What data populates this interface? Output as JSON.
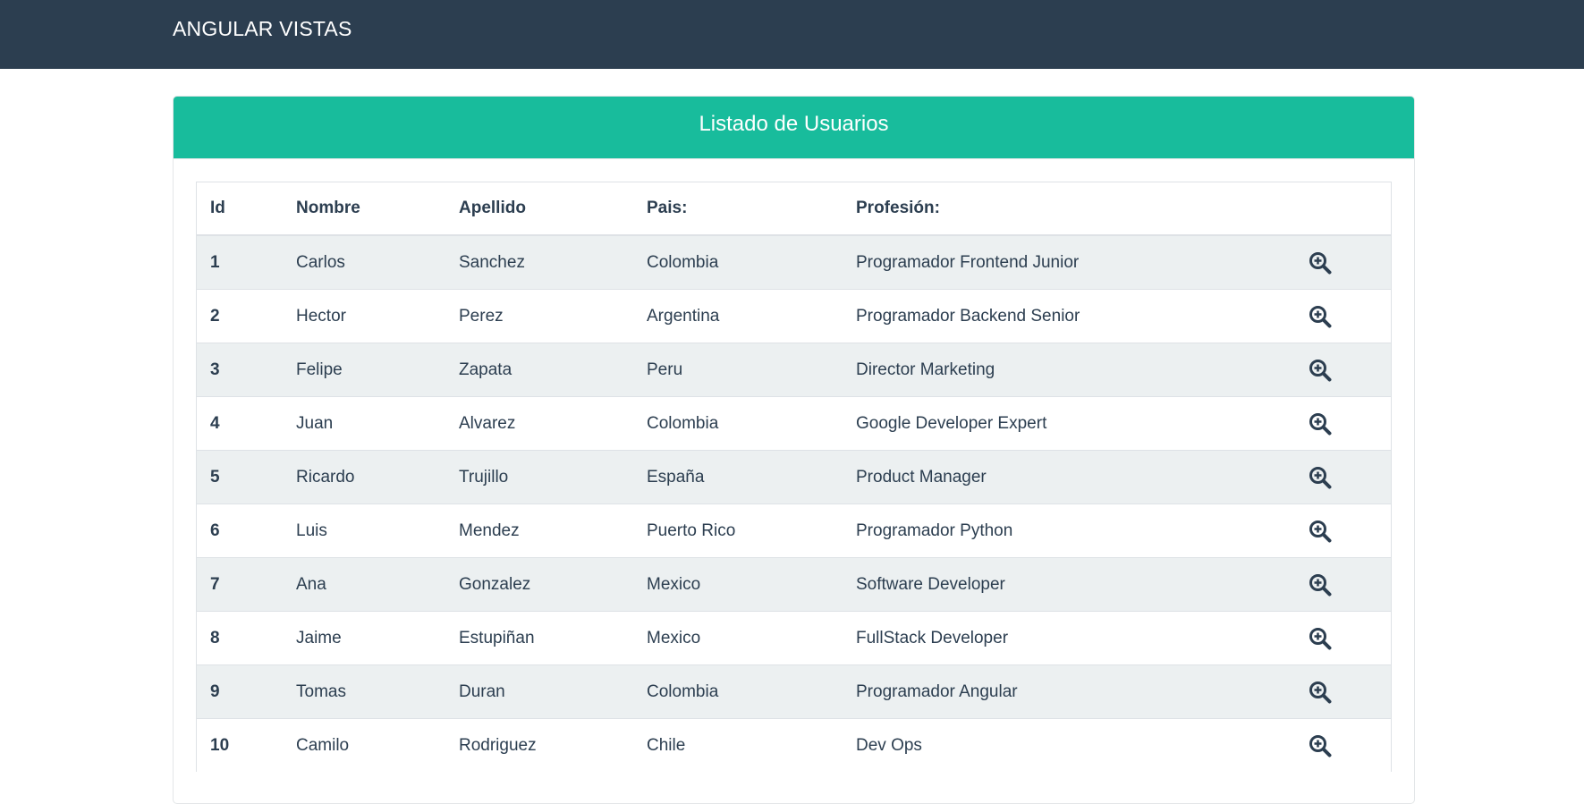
{
  "navbar": {
    "brand": "ANGULAR VISTAS"
  },
  "card": {
    "title": "Listado de Usuarios"
  },
  "table": {
    "headers": [
      "Id",
      "Nombre",
      "Apellido",
      "Pais:",
      "Profesión:"
    ],
    "rows": [
      {
        "id": "1",
        "nombre": "Carlos",
        "apellido": "Sanchez",
        "pais": "Colombia",
        "profesion": "Programador Frontend Junior"
      },
      {
        "id": "2",
        "nombre": "Hector",
        "apellido": "Perez",
        "pais": "Argentina",
        "profesion": "Programador Backend Senior"
      },
      {
        "id": "3",
        "nombre": "Felipe",
        "apellido": "Zapata",
        "pais": "Peru",
        "profesion": "Director Marketing"
      },
      {
        "id": "4",
        "nombre": "Juan",
        "apellido": "Alvarez",
        "pais": "Colombia",
        "profesion": "Google Developer Expert"
      },
      {
        "id": "5",
        "nombre": "Ricardo",
        "apellido": "Trujillo",
        "pais": "España",
        "profesion": "Product Manager"
      },
      {
        "id": "6",
        "nombre": "Luis",
        "apellido": "Mendez",
        "pais": "Puerto Rico",
        "profesion": "Programador Python"
      },
      {
        "id": "7",
        "nombre": "Ana",
        "apellido": "Gonzalez",
        "pais": "Mexico",
        "profesion": "Software Developer"
      },
      {
        "id": "8",
        "nombre": "Jaime",
        "apellido": "Estupiñan",
        "pais": "Mexico",
        "profesion": "FullStack Developer"
      },
      {
        "id": "9",
        "nombre": "Tomas",
        "apellido": "Duran",
        "pais": "Colombia",
        "profesion": "Programador Angular"
      },
      {
        "id": "10",
        "nombre": "Camilo",
        "apellido": "Rodriguez",
        "pais": "Chile",
        "profesion": "Dev Ops"
      }
    ],
    "action_icon": "search-plus-icon"
  },
  "colors": {
    "navbar": "#2c3e50",
    "header": "#18bc9c",
    "stripe": "#ecf0f1"
  }
}
